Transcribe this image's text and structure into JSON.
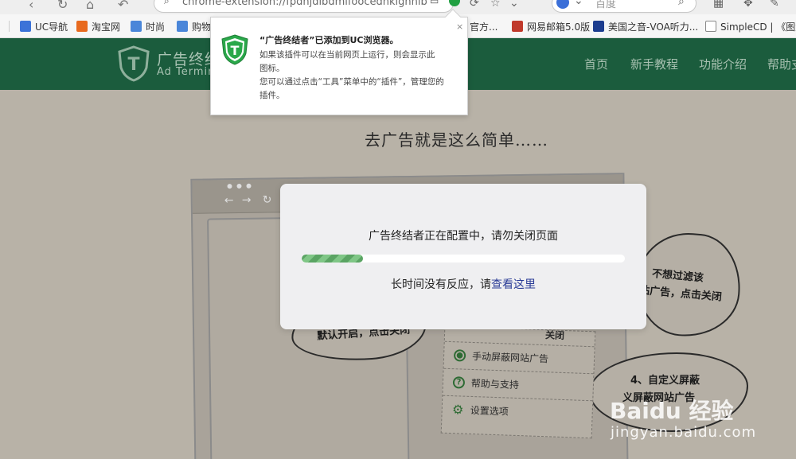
{
  "browser": {
    "address_text": "chrome-extension://fpdnjdlbdmifoocedhkighhlb",
    "search_placeholder": "百度",
    "bookmarks": [
      {
        "label": "UC导航",
        "color": "#3b73d8"
      },
      {
        "label": "淘宝网",
        "color": "#e86a1f"
      },
      {
        "label": "时尚",
        "color": "#4a86d9"
      },
      {
        "label": "购物",
        "color": "#4a86d9"
      },
      {
        "label": "官方...",
        "color": "#888888"
      },
      {
        "label": "网易邮箱5.0版",
        "color": "#c0392b"
      },
      {
        "label": "美国之音-VOA听力...",
        "color": "#1d3d8f"
      },
      {
        "label": "SimpleCD | 《图解",
        "color": "#888888"
      }
    ]
  },
  "site": {
    "logo_cn": "广告终结",
    "logo_en": "Ad Termin",
    "nav": [
      "首页",
      "新手教程",
      "功能介绍",
      "帮助支"
    ],
    "page_title": "去广告就是这么简单……"
  },
  "illustration": {
    "cloud_left_text": "默认开启，点击关闭",
    "cloud_right_text": [
      "不想过滤该",
      "站广告，点击关闭"
    ],
    "cloud_br_text": [
      "4、自定义屏蔽",
      "义屏蔽网站广告"
    ],
    "menu_top_text": "关闭",
    "menu_items": [
      "手动屏蔽网站广告",
      "帮助与支持",
      "设置选项"
    ]
  },
  "dialog": {
    "message": "广告终结者正在配置中，请勿关闭页面",
    "progress": 0.19,
    "help_prefix": "长时间没有反应，请",
    "help_link": "查看这里"
  },
  "popup": {
    "title": "“广告终结者”已添加到UC浏览器。",
    "lines": [
      "如果该插件可以在当前网页上运行，则会显示此",
      "图标。",
      "您可以通过点击“工具”菜单中的“插件”，管理您的",
      "插件。"
    ],
    "close": "×"
  },
  "watermark": {
    "logo": "Baidu 经验",
    "url": "jingyan.baidu.com"
  },
  "colors": {
    "header_green": "#1b5c3d",
    "progress_green": "#5aa463",
    "link_blue": "#2b3c96"
  }
}
